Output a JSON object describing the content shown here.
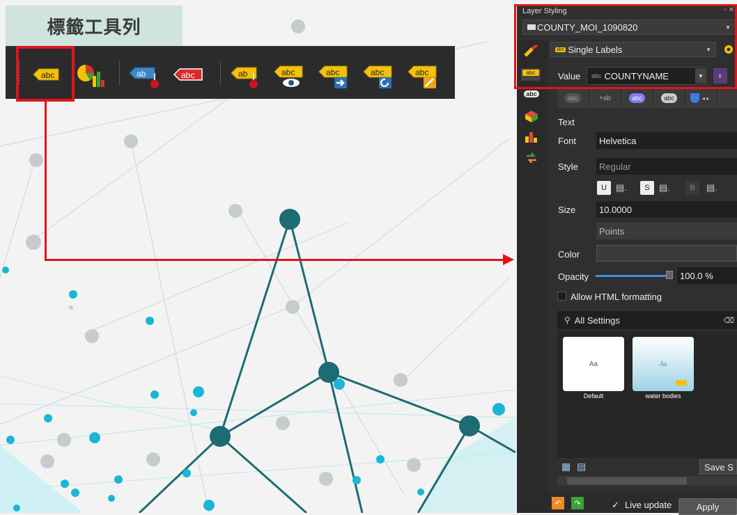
{
  "slide": {
    "title": "標籤工具列"
  },
  "toolbar": {
    "buttons": [
      {
        "name": "layer-labeling-options",
        "text": "abc"
      },
      {
        "name": "layer-diagram-options",
        "text": ""
      },
      {
        "name": "pin-labels",
        "text": "ab"
      },
      {
        "name": "highlight-pinned-labels",
        "text": "abc"
      },
      {
        "name": "pin-diagrams",
        "text": "ab"
      },
      {
        "name": "show-hide-labels",
        "text": "abc"
      },
      {
        "name": "move-label",
        "text": "abc"
      },
      {
        "name": "rotate-label",
        "text": "abc"
      },
      {
        "name": "change-label",
        "text": "abc"
      }
    ]
  },
  "panel": {
    "title": "Layer Styling",
    "layer": "COUNTY_MOI_1090820",
    "mode": "Single Labels",
    "value_label": "Value",
    "value_prefix": "abc",
    "value_field": "COUNTYNAME",
    "section_text": "Text",
    "font_label": "Font",
    "font_value": "Helvetica",
    "style_label": "Style",
    "style_value": "Regular",
    "u_btn": "U",
    "s_btn": "S",
    "b_btn": "B",
    "size_label": "Size",
    "size_value": "10.0000",
    "unit_value": "Points",
    "color_label": "Color",
    "opacity_label": "Opacity",
    "opacity_value": "100.0 %",
    "opacity_level": 1.0,
    "html_formatting": "Allow HTML formatting",
    "search_label": "All Settings",
    "symbols": [
      {
        "label": "Default",
        "preview": "Aa"
      },
      {
        "label": "water bodies",
        "preview": "Aa"
      }
    ],
    "save_label": "Save S",
    "live_update": "Live update",
    "live_check": "✓",
    "apply": "Apply"
  }
}
